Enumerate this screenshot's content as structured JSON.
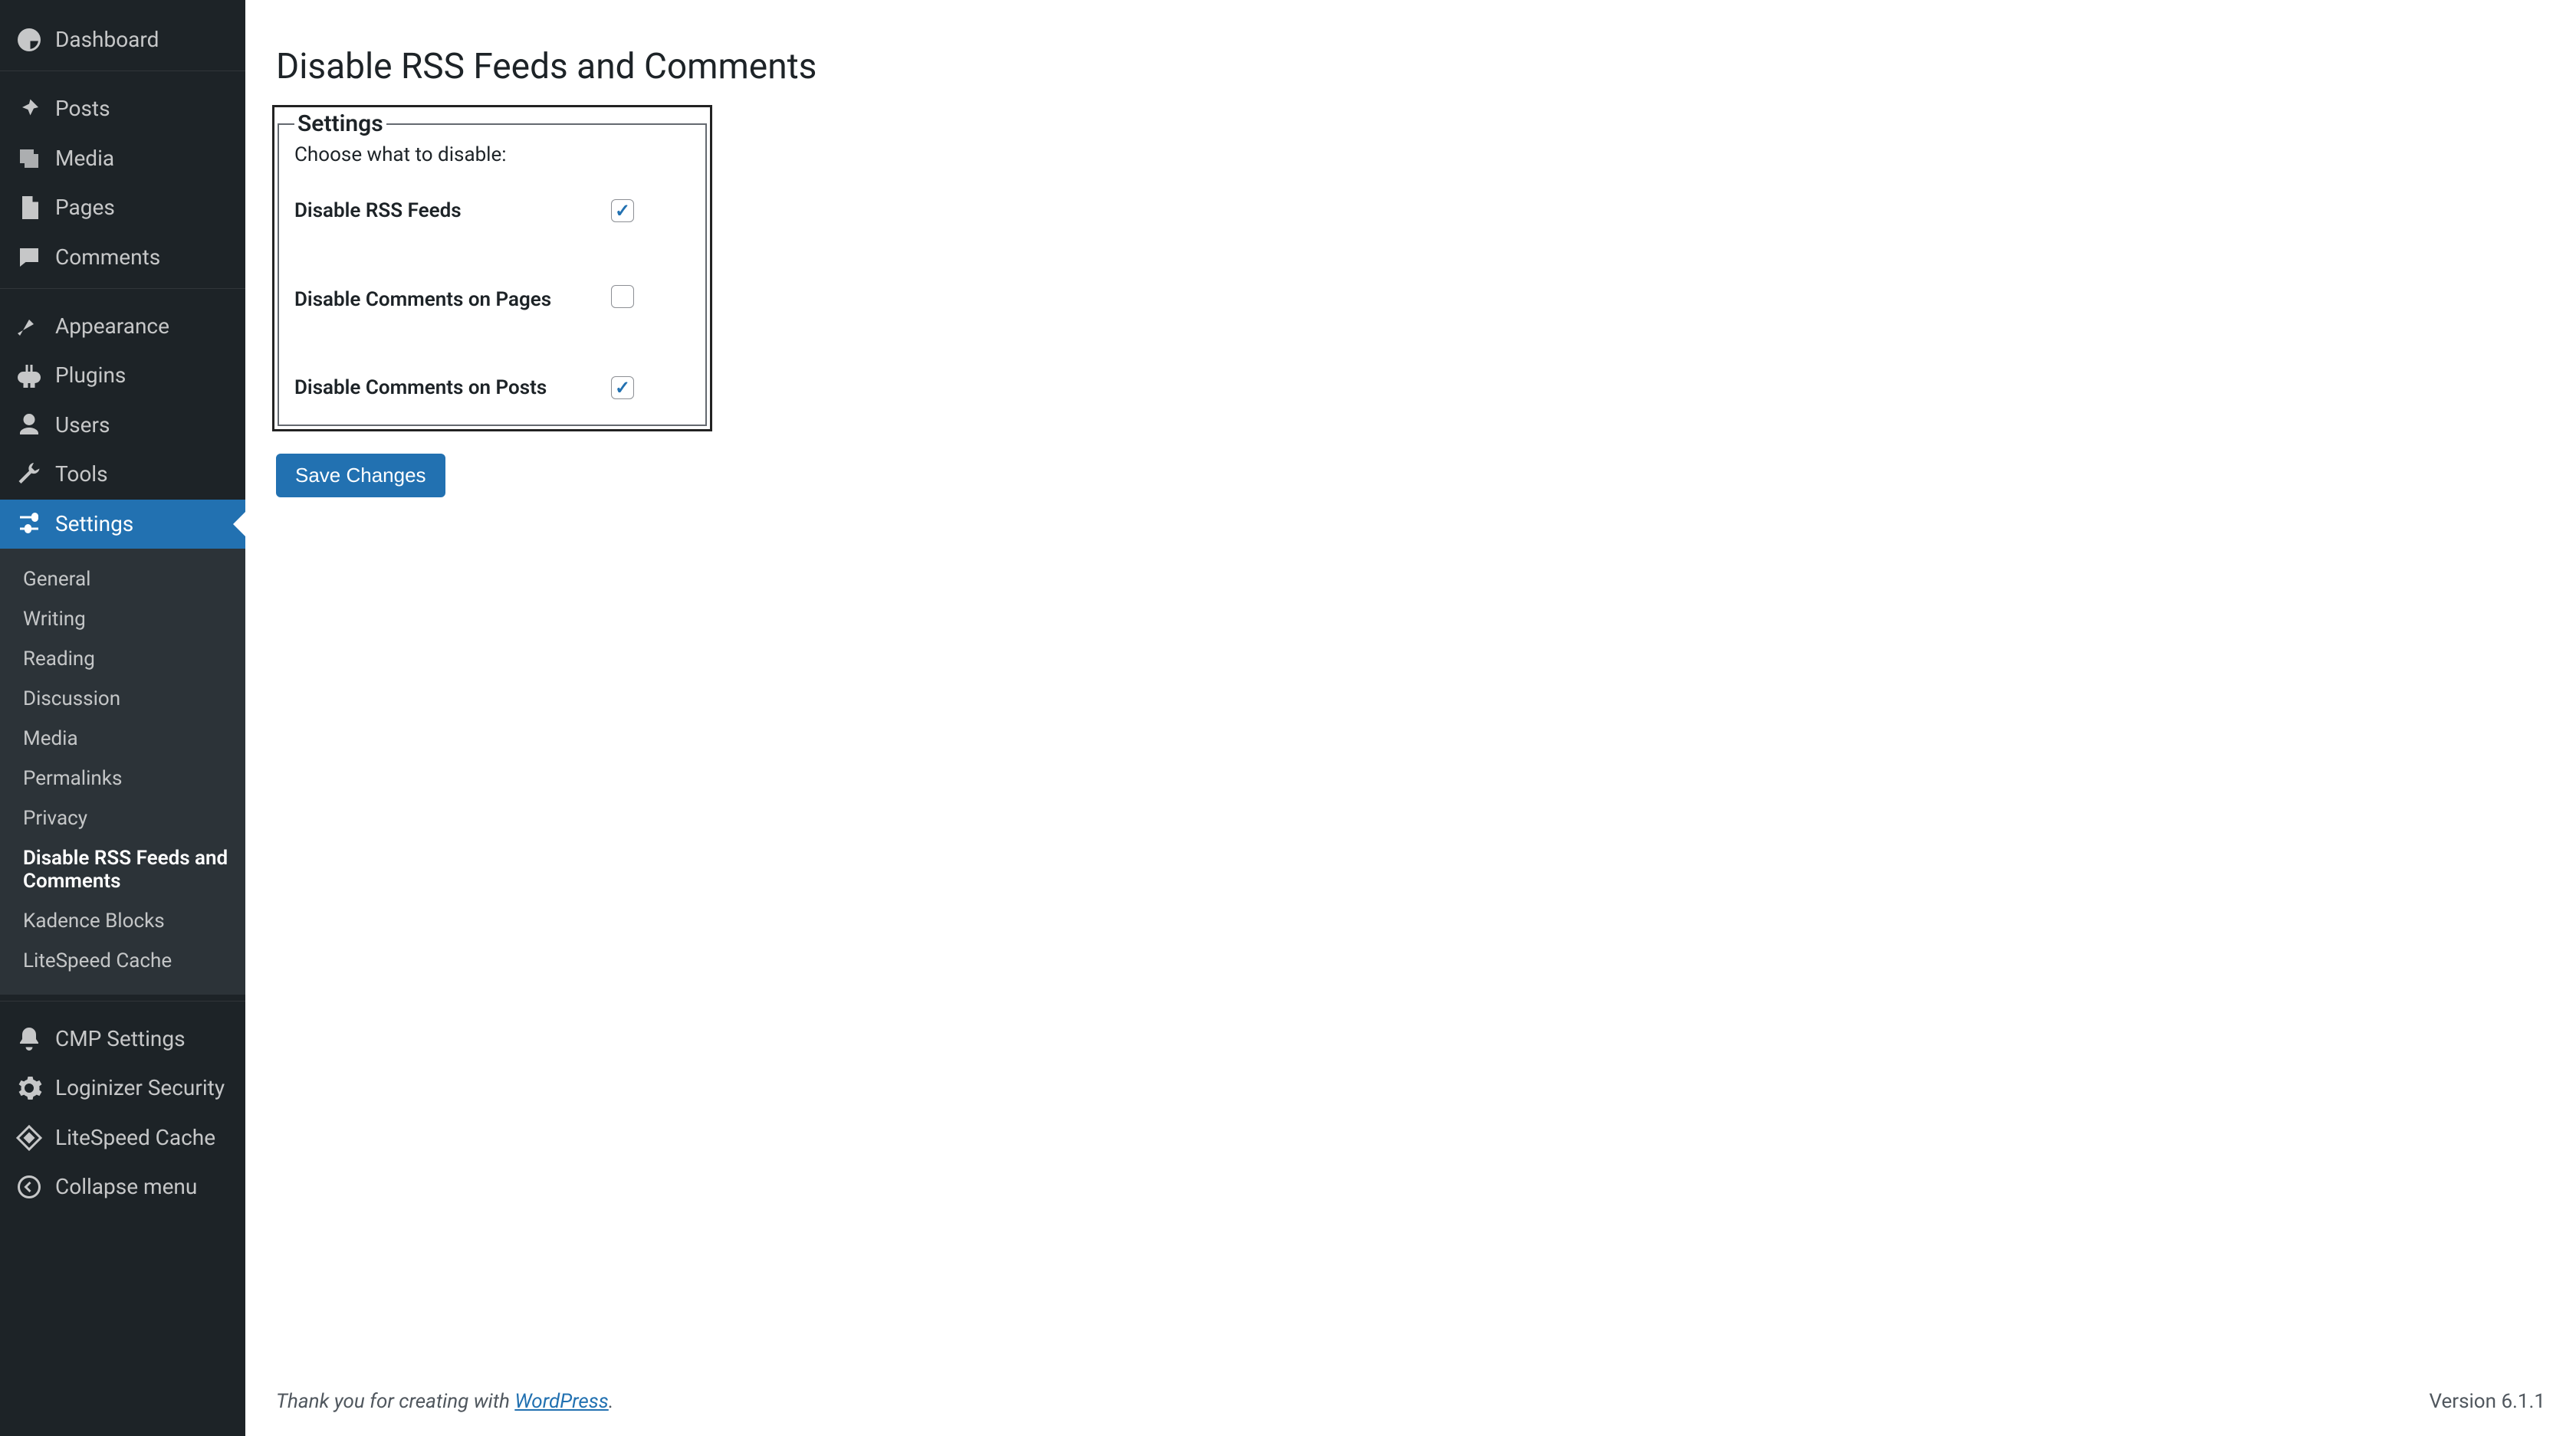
{
  "sidebar": {
    "main": [
      {
        "label": "Dashboard",
        "icon": "dashboard-icon"
      },
      {
        "label": "Posts",
        "icon": "pin-icon"
      },
      {
        "label": "Media",
        "icon": "media-icon"
      },
      {
        "label": "Pages",
        "icon": "pages-icon"
      },
      {
        "label": "Comments",
        "icon": "comments-icon"
      },
      {
        "label": "Appearance",
        "icon": "appearance-icon"
      },
      {
        "label": "Plugins",
        "icon": "plugin-icon"
      },
      {
        "label": "Users",
        "icon": "users-icon"
      },
      {
        "label": "Tools",
        "icon": "tools-icon"
      },
      {
        "label": "Settings",
        "icon": "settings-icon",
        "current": true
      }
    ],
    "settings_submenu": [
      {
        "label": "General"
      },
      {
        "label": "Writing"
      },
      {
        "label": "Reading"
      },
      {
        "label": "Discussion"
      },
      {
        "label": "Media"
      },
      {
        "label": "Permalinks"
      },
      {
        "label": "Privacy"
      },
      {
        "label": "Disable RSS Feeds and Comments",
        "current": true
      },
      {
        "label": "Kadence Blocks"
      },
      {
        "label": "LiteSpeed Cache"
      }
    ],
    "tail": [
      {
        "label": "CMP Settings",
        "icon": "bell-icon"
      },
      {
        "label": "Loginizer Security",
        "icon": "gear-icon"
      },
      {
        "label": "LiteSpeed Cache",
        "icon": "litespeed-icon"
      }
    ],
    "collapse_label": "Collapse menu"
  },
  "page": {
    "title": "Disable RSS Feeds and Comments",
    "fieldset_legend": "Settings",
    "fieldset_hint": "Choose what to disable:",
    "options": [
      {
        "label": "Disable RSS Feeds",
        "checked": true
      },
      {
        "label": "Disable Comments on Pages",
        "checked": false
      },
      {
        "label": "Disable Comments on Posts",
        "checked": true
      }
    ],
    "save_label": "Save Changes"
  },
  "footer": {
    "thank_prefix": "Thank you for creating with ",
    "wp_link_text": "WordPress",
    "thank_suffix": ".",
    "version_text": "Version 6.1.1"
  }
}
